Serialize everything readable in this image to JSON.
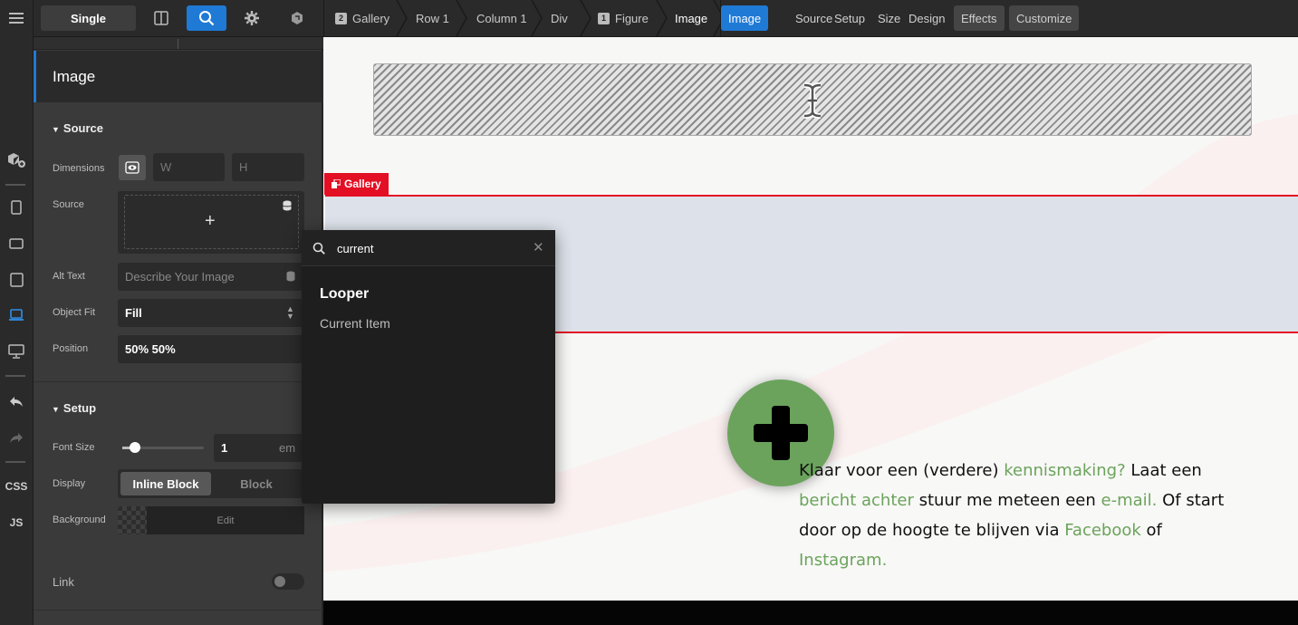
{
  "rail": {
    "css_label": "CSS",
    "js_label": "JS"
  },
  "topbar": {
    "single_label": "Single",
    "breadcrumb": [
      {
        "num": "2",
        "label": "Gallery"
      },
      {
        "num": "",
        "label": "Row 1"
      },
      {
        "num": "",
        "label": "Column 1"
      },
      {
        "num": "",
        "label": "Div"
      },
      {
        "num": "1",
        "label": "Figure"
      },
      {
        "num": "",
        "label": "Image"
      }
    ],
    "tabs": [
      "Image",
      "Source",
      "Setup",
      "Size",
      "Design",
      "Effects",
      "Customize"
    ],
    "active_tab": "Image",
    "accent": "#1f7ad6"
  },
  "panel": {
    "title": "Image",
    "source_section": "Source",
    "dimensions_label": "Dimensions",
    "width_placeholder": "W",
    "height_placeholder": "H",
    "source_label": "Source",
    "alt_label": "Alt Text",
    "alt_placeholder": "Describe Your Image",
    "fit_label": "Object Fit",
    "fit_value": "Fill",
    "position_label": "Position",
    "position_value": "50% 50%",
    "setup_section": "Setup",
    "font_size_label": "Font Size",
    "font_size_value": "1",
    "font_size_unit": "em",
    "font_size_slider": 0.15,
    "display_label": "Display",
    "display_options": [
      "Inline Block",
      "Block"
    ],
    "display_selected": "Inline Block",
    "background_label": "Background",
    "background_edit": "Edit",
    "link_label": "Link",
    "link_on": false
  },
  "canvas": {
    "gallery_tag": "Gallery",
    "gallery_color": "#e30f24",
    "cta_parts": [
      {
        "t": "Klaar voor een (verdere) ",
        "g": false
      },
      {
        "t": "kennismaking?",
        "g": true
      },
      {
        "t": " Laat een ",
        "g": false
      },
      {
        "t": "bericht achter",
        "g": true
      },
      {
        "t": " stuur me meteen een ",
        "g": false
      },
      {
        "t": "e-mail.",
        "g": true
      },
      {
        "t": " Of start door op de hoogte te blijven via ",
        "g": false
      },
      {
        "t": "Facebook",
        "g": true
      },
      {
        "t": " of ",
        "g": false
      },
      {
        "t": "Instagram.",
        "g": true
      }
    ],
    "green": "#6ba35c"
  },
  "popup": {
    "query": "current",
    "group": "Looper",
    "results": [
      "Current Item"
    ]
  }
}
